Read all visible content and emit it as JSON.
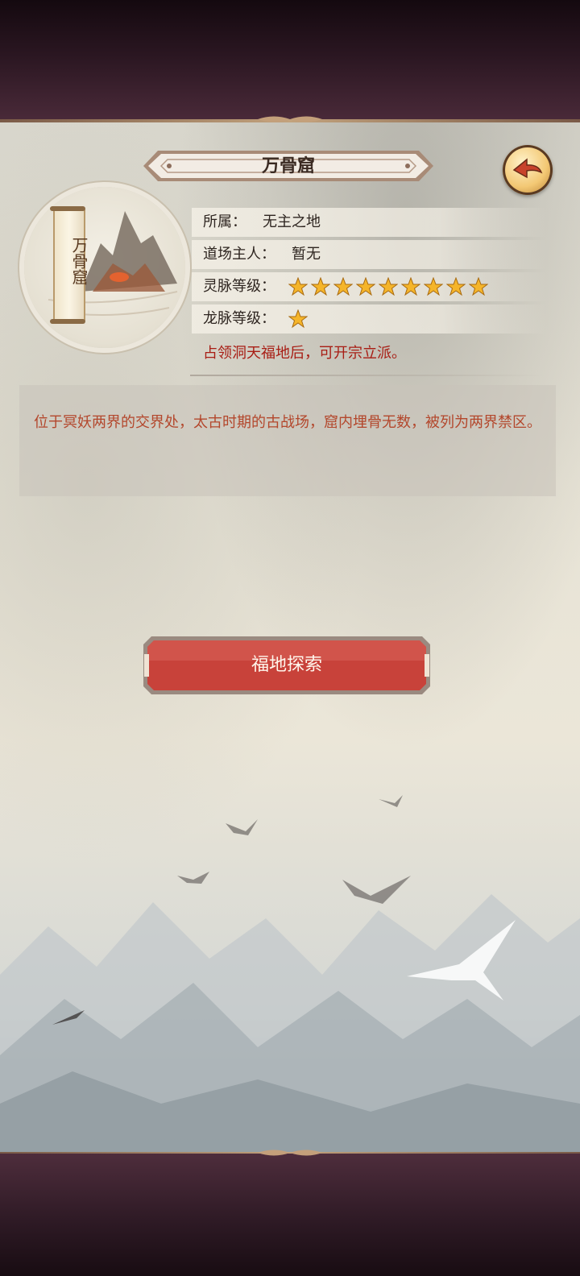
{
  "header": {
    "title": "万骨窟"
  },
  "location": {
    "scroll_name": "万骨窟",
    "rows": [
      {
        "label": "所属：",
        "value": "无主之地"
      },
      {
        "label": "道场主人：",
        "value": "暂无"
      },
      {
        "label": "灵脉等级：",
        "stars": 9
      },
      {
        "label": "龙脉等级：",
        "stars": 1
      }
    ],
    "note": "占领洞天福地后，可开宗立派。"
  },
  "description": "位于冥妖两界的交界处，太古时期的古战场，窟内埋骨无数，被列为两界禁区。",
  "actions": {
    "explore_label": "福地探索"
  },
  "icons": {
    "back": "back-arrow-icon",
    "star": "star-icon"
  },
  "colors": {
    "accent_red": "#c8423a",
    "note_red": "#a81d14",
    "desc_text": "#b3472c",
    "star_gold": "#f5b52a"
  }
}
